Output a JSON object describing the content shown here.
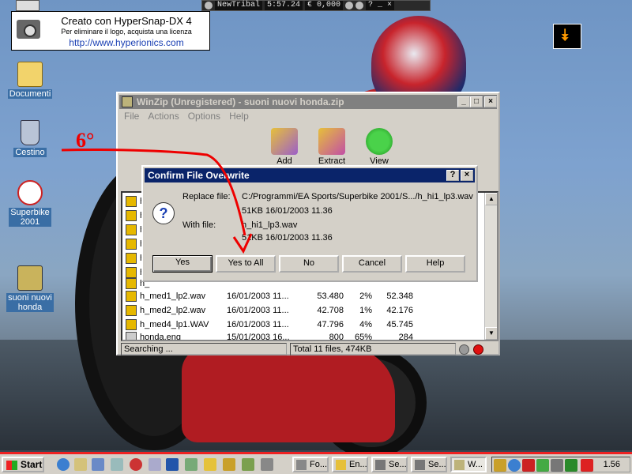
{
  "topbar": {
    "name": "NewTribal",
    "time": "5:57.24",
    "money": "€ 0,000",
    "extra": "? _ ×"
  },
  "hypersnap": {
    "line1": "Creato con HyperSnap-DX 4",
    "line2": "Per eliminare il logo, acquista una licenza",
    "line3": "http://www.hyperionics.com"
  },
  "desktop": {
    "icons": [
      {
        "label": "Documenti"
      },
      {
        "label": "Cestino"
      },
      {
        "label": "Superbike 2001"
      },
      {
        "label": "suoni nuovi honda"
      }
    ]
  },
  "annotation": {
    "text": "6°"
  },
  "winzip": {
    "title": "WinZip (Unregistered) - suoni nuovi honda.zip",
    "menu": [
      "File",
      "Actions",
      "Options",
      "Help"
    ],
    "tools": [
      "Add",
      "Extract",
      "View"
    ],
    "rows": [
      {
        "name": "h_med1_lp2.wav",
        "date": "16/01/2003 11...",
        "size": "53.480",
        "ratio": "2%",
        "packed": "52.348"
      },
      {
        "name": "h_med2_lp2.wav",
        "date": "16/01/2003 11...",
        "size": "42.708",
        "ratio": "1%",
        "packed": "42.176"
      },
      {
        "name": "h_med4_lp1.WAV",
        "date": "16/01/2003 11...",
        "size": "47.796",
        "ratio": "4%",
        "packed": "45.745"
      },
      {
        "name": "honda.eng",
        "date": "15/01/2003 16...",
        "size": "800",
        "ratio": "65%",
        "packed": "284"
      }
    ],
    "partial_prefix": "h",
    "partial_last": "h_",
    "status_left": "Searching ...",
    "status_right": "Total 11 files, 474KB"
  },
  "dialog": {
    "title": "Confirm File Overwrite",
    "replace_label": "Replace file:",
    "replace_path": "C:/Programmi/EA Sports/Superbike 2001/S.../h_hi1_lp3.wav",
    "replace_info": "51KB  16/01/2003  11.36",
    "with_label": "With file:",
    "with_name": "h_hi1_lp3.wav",
    "with_info": "51KB  16/01/2003  11.36",
    "buttons": [
      "Yes",
      "Yes to All",
      "No",
      "Cancel",
      "Help"
    ],
    "help_q": "?",
    "close": "×"
  },
  "taskbar": {
    "start": "Start",
    "tasks": [
      "Fo...",
      "En...",
      "Se...",
      "Se...",
      "W..."
    ],
    "clock": "1.56"
  }
}
